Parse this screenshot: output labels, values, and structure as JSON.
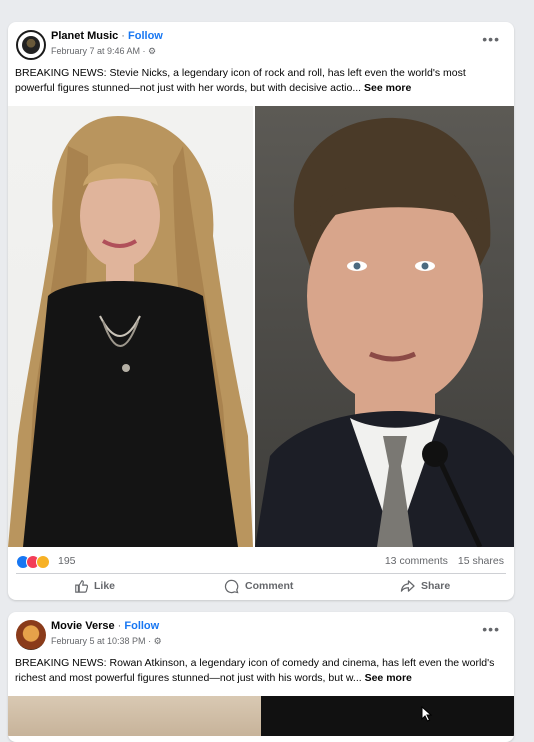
{
  "posts": [
    {
      "page_name": "Planet Music",
      "follow_label": "Follow",
      "timestamp": "February 7 at 9:46 AM",
      "text": "BREAKING NEWS: Stevie Nicks, a legendary icon of rock and roll, has left even the world's most powerful figures stunned—not just with her words, but with decisive actio...",
      "see_more": "See more",
      "reaction_count": "195",
      "comments": "13 comments",
      "shares": "15 shares",
      "actions": {
        "like": "Like",
        "comment": "Comment",
        "share": "Share"
      }
    },
    {
      "page_name": "Movie Verse",
      "follow_label": "Follow",
      "timestamp": "February 5 at 10:38 PM",
      "text": "BREAKING NEWS: Rowan Atkinson, a legendary icon of comedy and cinema, has left even the world's richest and most powerful figures stunned—not just with his words, but w...",
      "see_more": "See more"
    }
  ],
  "colors": {
    "accent": "#1877f2",
    "secondary_text": "#65676b",
    "background": "#e9ebee"
  },
  "icons": [
    "like-icon",
    "comment-icon",
    "share-icon",
    "globe-icon",
    "more-options-icon"
  ]
}
